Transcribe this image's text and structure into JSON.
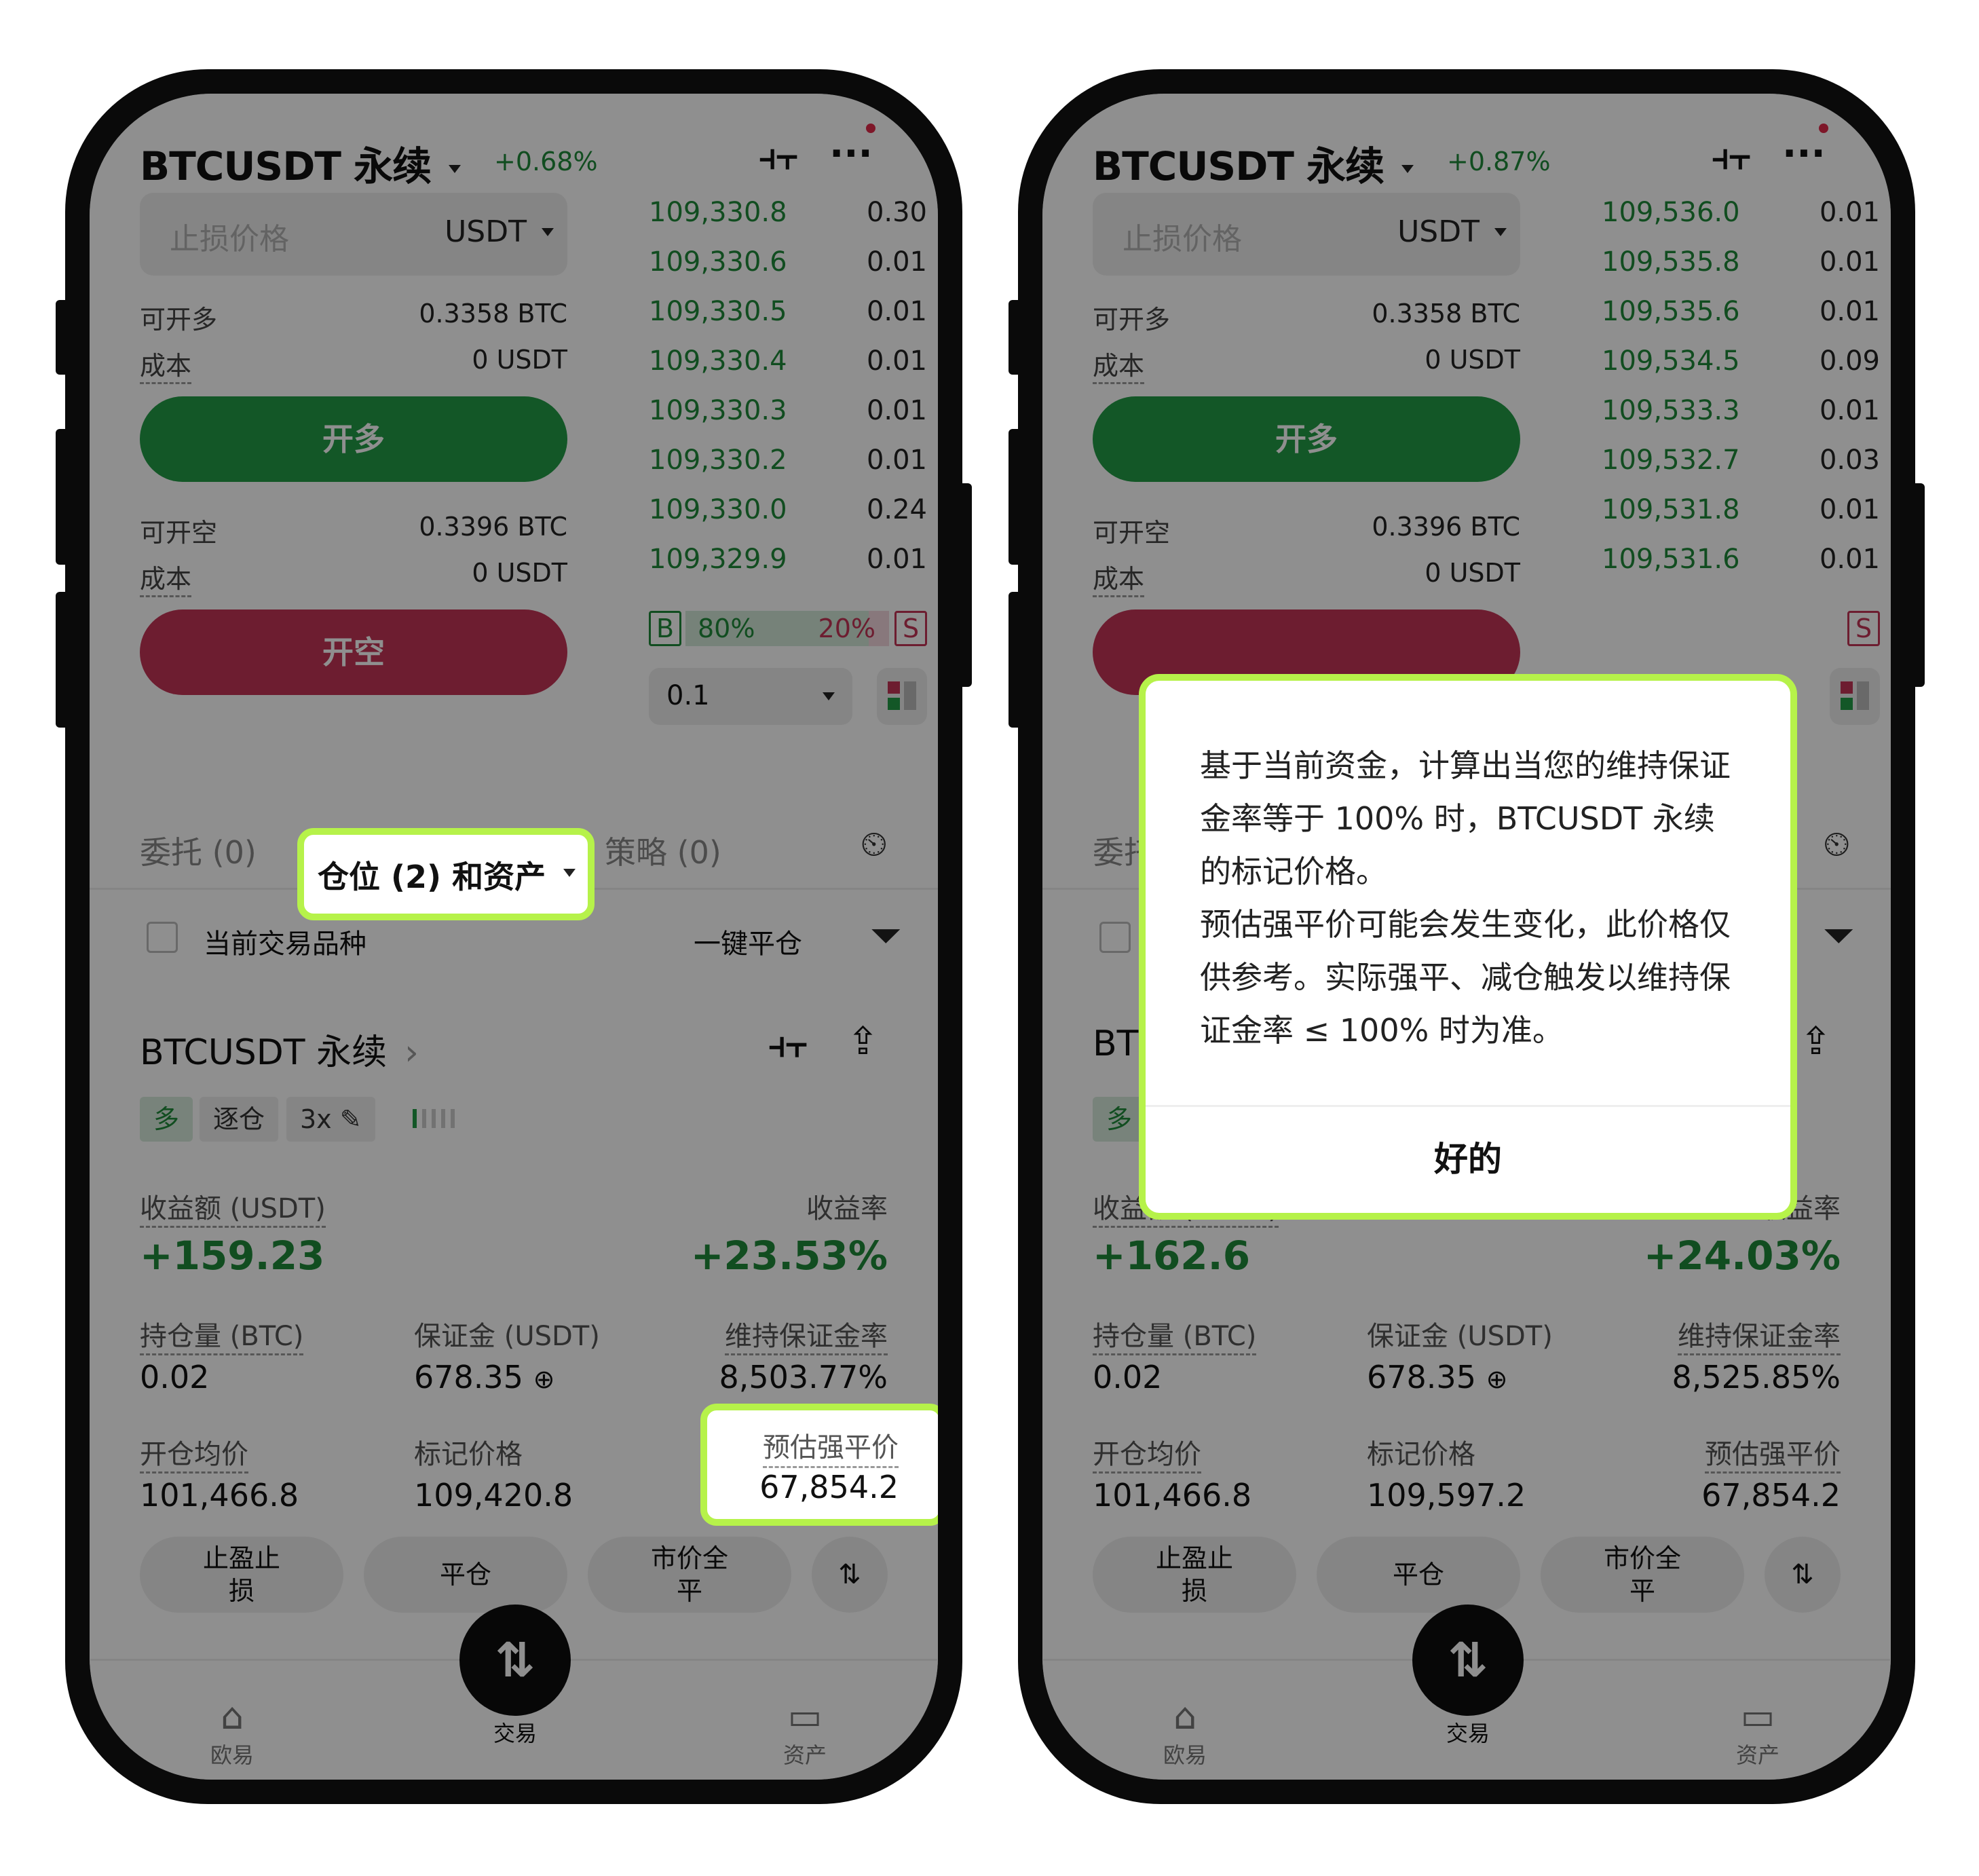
{
  "left": {
    "symbol": "BTCUSDT 永续",
    "change": "+0.68%",
    "input": {
      "placeholder": "止损价格",
      "unit": "USDT"
    },
    "long": {
      "avail_label": "可开多",
      "avail_value": "0.3358 BTC",
      "cost_label": "成本",
      "cost_value": "0 USDT",
      "button": "开多"
    },
    "short": {
      "avail_label": "可开空",
      "avail_value": "0.3396 BTC",
      "cost_label": "成本",
      "cost_value": "0 USDT",
      "button": "开空"
    },
    "orderbook": [
      {
        "price": "109,330.8",
        "qty": "0.30"
      },
      {
        "price": "109,330.6",
        "qty": "0.01"
      },
      {
        "price": "109,330.5",
        "qty": "0.01"
      },
      {
        "price": "109,330.4",
        "qty": "0.01"
      },
      {
        "price": "109,330.3",
        "qty": "0.01"
      },
      {
        "price": "109,330.2",
        "qty": "0.01"
      },
      {
        "price": "109,330.0",
        "qty": "0.24"
      },
      {
        "price": "109,329.9",
        "qty": "0.01"
      }
    ],
    "ratio": {
      "b": "B",
      "b_pct": "80%",
      "s_pct": "20%",
      "s": "S"
    },
    "qty_value": "0.1",
    "tabs": {
      "orders": "委托 (0)",
      "positions": "仓位 (2) 和资产",
      "strategy": "策略 (0)"
    },
    "filter_label": "当前交易品种",
    "close_all": "一键平仓",
    "position": {
      "name": "BTCUSDT 永续",
      "tag_side": "多",
      "tag_margin": "逐仓",
      "tag_leverage": "3x",
      "pnl_label": "收益额 (USDT)",
      "pnl_value": "+159.23",
      "roe_label": "收益率",
      "roe_value": "+23.53%",
      "size_label": "持仓量 (BTC)",
      "size_value": "0.02",
      "margin_label": "保证金 (USDT)",
      "margin_value": "678.35",
      "mmr_label": "维持保证金率",
      "mmr_value": "8,503.77%",
      "entry_label": "开仓均价",
      "entry_value": "101,466.8",
      "mark_label": "标记价格",
      "mark_value": "109,420.8",
      "liq_label": "预估强平价",
      "liq_value": "67,854.2"
    },
    "actions": {
      "tpsl": "止盈止\n损",
      "close": "平仓",
      "market_close": "市价全\n平"
    },
    "nav": {
      "home": "欧易",
      "trade": "交易",
      "assets": "资产"
    }
  },
  "right": {
    "symbol": "BTCUSDT 永续",
    "change": "+0.87%",
    "input": {
      "placeholder": "止损价格",
      "unit": "USDT"
    },
    "long": {
      "avail_label": "可开多",
      "avail_value": "0.3358 BTC",
      "cost_label": "成本",
      "cost_value": "0 USDT",
      "button": "开多"
    },
    "short": {
      "avail_label": "可开空",
      "avail_value": "0.3396 BTC",
      "cost_label": "成本",
      "cost_value": "0 USDT"
    },
    "orderbook": [
      {
        "price": "109,536.0",
        "qty": "0.01"
      },
      {
        "price": "109,535.8",
        "qty": "0.01"
      },
      {
        "price": "109,535.6",
        "qty": "0.01"
      },
      {
        "price": "109,534.5",
        "qty": "0.09"
      },
      {
        "price": "109,533.3",
        "qty": "0.01"
      },
      {
        "price": "109,532.7",
        "qty": "0.03"
      },
      {
        "price": "109,531.8",
        "qty": "0.01"
      },
      {
        "price": "109,531.6",
        "qty": "0.01"
      }
    ],
    "position": {
      "pnl_label": "收益额 (USDT)",
      "pnl_value": "+162.6",
      "roe_label": "收益率",
      "roe_value": "+24.03%",
      "size_label": "持仓量 (BTC)",
      "size_value": "0.02",
      "margin_label": "保证金 (USDT)",
      "margin_value": "678.35",
      "mmr_label": "维持保证金率",
      "mmr_value": "8,525.85%",
      "entry_label": "开仓均价",
      "entry_value": "101,466.8",
      "mark_label": "标记价格",
      "mark_value": "109,597.2",
      "liq_label": "预估强平价",
      "liq_value": "67,854.2"
    },
    "actions": {
      "tpsl": "止盈止\n损",
      "close": "平仓",
      "market_close": "市价全\n平"
    },
    "nav": {
      "home": "欧易",
      "trade": "交易",
      "assets": "资产"
    },
    "modal": {
      "text": "基于当前资金，计算出当您的维持保证金率等于 100% 时，BTCUSDT 永续 的标记价格。\n预估强平价可能会发生变化，此价格仅供参考。实际强平、减仓触发以维持保证金率 ≤ 100% 时为准。",
      "ok": "好的"
    }
  },
  "colors": {
    "green": "#1f8a3a",
    "red": "#c33456",
    "highlight": "#b6f24a"
  }
}
